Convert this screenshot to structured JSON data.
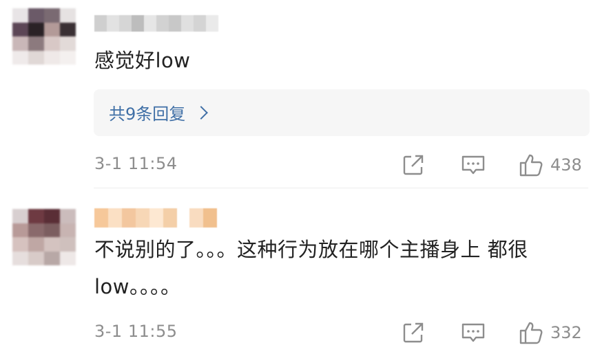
{
  "comments": [
    {
      "text": "感觉好low",
      "replies_label": "共9条回复",
      "time": "3-1 11:54",
      "likes": "438",
      "avatar_colors": [
        "#e8e4e6",
        "#6b5a68",
        "#7a6a72",
        "#e6e2e2",
        "#5c4656",
        "#2a2226",
        "#b39a98",
        "#3a3034",
        "#c9b7b8",
        "#8c7a7e",
        "#d8c8c6",
        "#e2dad8",
        "#efeaea",
        "#e0d8d6",
        "#efe9e8",
        "#f4f0ef"
      ],
      "username_colors": [
        "#cfcfcf",
        "#e2e2e2",
        "#d6d6d6",
        "#bdbdbd",
        "#e6e6e6",
        "#d2d2d2",
        "#c8c8c8",
        "#e0e0e0",
        "#d4d4d4",
        "#eaeaea"
      ]
    },
    {
      "text": "不说别的了。。。这种行为放在哪个主播身上 都很low。。。。",
      "time": "3-1 11:55",
      "likes": "332",
      "avatar_colors": [
        "#d8cfd0",
        "#6e3a42",
        "#5a2e36",
        "#cbbcbc",
        "#b89a98",
        "#8a6a6c",
        "#7c5e60",
        "#c8b4b2",
        "#d6c2bf",
        "#bfa7a4",
        "#d4c3c0",
        "#cfc0bd",
        "#e6dedd",
        "#d8cbc8",
        "#b8a8a6",
        "#eee8e7"
      ],
      "username_colors": [
        "#f6c89a",
        "#fbe0c4",
        "#f3c79f",
        "#f7d7b6",
        "#fde8d2",
        "#f4cfa8",
        "#f9dcc0",
        "#f1c08e"
      ]
    }
  ],
  "icons": {
    "share": "share-icon",
    "comment": "comment-icon",
    "like": "thumbs-up-icon"
  },
  "colors": {
    "link": "#3f6fa6",
    "meta": "#8d8d8d",
    "text": "#222222",
    "reply_bg": "#f6f6f6"
  }
}
